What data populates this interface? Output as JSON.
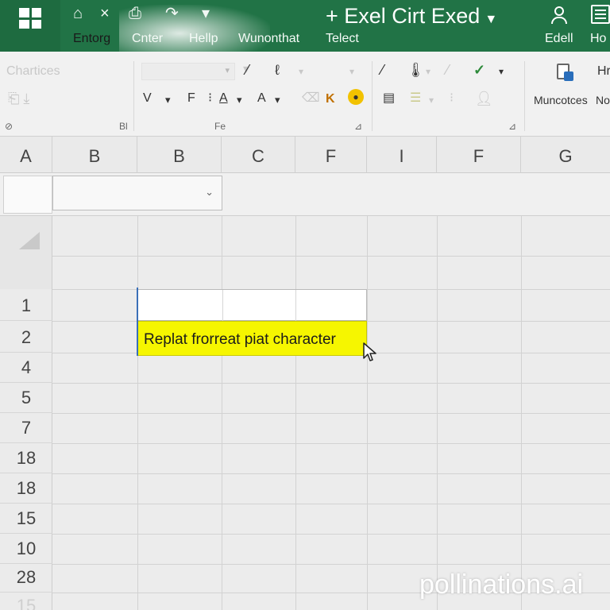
{
  "window": {
    "title": "+ Exel Cirt Exed",
    "title_caret": "▼"
  },
  "quick_access": [
    {
      "name": "home-icon",
      "glyph": "⌂"
    },
    {
      "name": "close-icon",
      "glyph": "×"
    },
    {
      "name": "save-icon",
      "glyph": "⎙"
    },
    {
      "name": "redo-icon",
      "glyph": "↷"
    },
    {
      "name": "dropdown-icon",
      "glyph": "▾"
    }
  ],
  "tabs": [
    {
      "label": "Entorg",
      "active": true
    },
    {
      "label": "Cnter"
    },
    {
      "label": "Hellp"
    },
    {
      "label": "Wunonthat"
    },
    {
      "label": "Telect"
    },
    {
      "label": "Edell"
    },
    {
      "label": "Ho"
    }
  ],
  "ribbon": {
    "clipboard_label": "Chartices",
    "font_group": {
      "row2": [
        "V",
        "▾",
        "F",
        "⁝",
        "A",
        "▾",
        "A",
        "▾",
        "K"
      ],
      "group_label": "Fe"
    },
    "group_label_left": "Bl",
    "side_label_1": "Hr",
    "side_label_2": "Muncotces",
    "side_label_3": "No",
    "launcher": "⊿",
    "launcher_left": "⊘"
  },
  "sheet": {
    "column_headers": [
      "A",
      "B",
      "B",
      "C",
      "F",
      "I",
      "F",
      "G"
    ],
    "row_headers": [
      "1",
      "2",
      "4",
      "5",
      "7",
      "18",
      "18",
      "15",
      "10",
      "28",
      "15"
    ],
    "name_box_caret": "⌄",
    "highlighted_cell_text": "Replat frorreat piat character"
  },
  "watermark": "pollinations.ai",
  "colors": {
    "title_bar": "#217346",
    "highlight": "#f6f600",
    "selection_border": "#3a6fb8"
  }
}
